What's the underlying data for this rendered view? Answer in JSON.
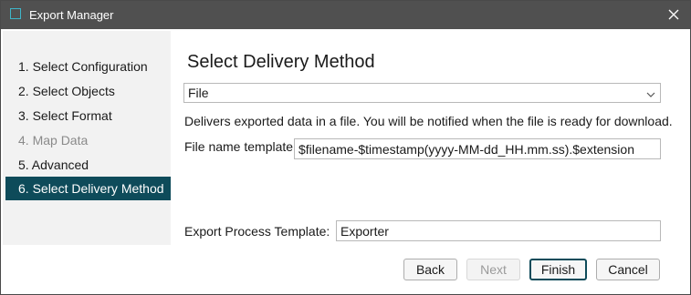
{
  "window": {
    "title": "Export Manager"
  },
  "sidebar": {
    "steps": [
      {
        "label": "1. Select Configuration",
        "state": "normal"
      },
      {
        "label": "2. Select Objects",
        "state": "normal"
      },
      {
        "label": "3. Select Format",
        "state": "normal"
      },
      {
        "label": "4. Map Data",
        "state": "disabled"
      },
      {
        "label": "5. Advanced",
        "state": "normal"
      },
      {
        "label": "6. Select Delivery Method",
        "state": "active"
      }
    ]
  },
  "main": {
    "heading": "Select Delivery Method",
    "delivery_method": {
      "selected": "File"
    },
    "description": "Delivers exported data in a file. You will be notified when the file is ready for download.",
    "file_name_template": {
      "label": "File name template",
      "value": "$filename-$timestamp(yyyy-MM-dd_HH.mm.ss).$extension"
    },
    "export_process_template": {
      "label": "Export Process Template:",
      "value": "Exporter"
    }
  },
  "footer": {
    "back_label": "Back",
    "next_label": "Next",
    "finish_label": "Finish",
    "cancel_label": "Cancel"
  },
  "colors": {
    "titlebar_bg": "#505050",
    "accent": "#0e4b5a",
    "sidebar_bg": "#f2f2f2"
  },
  "icons": {
    "app": "window-app-icon",
    "close": "close-icon",
    "dropdown": "chevron-down-icon"
  }
}
